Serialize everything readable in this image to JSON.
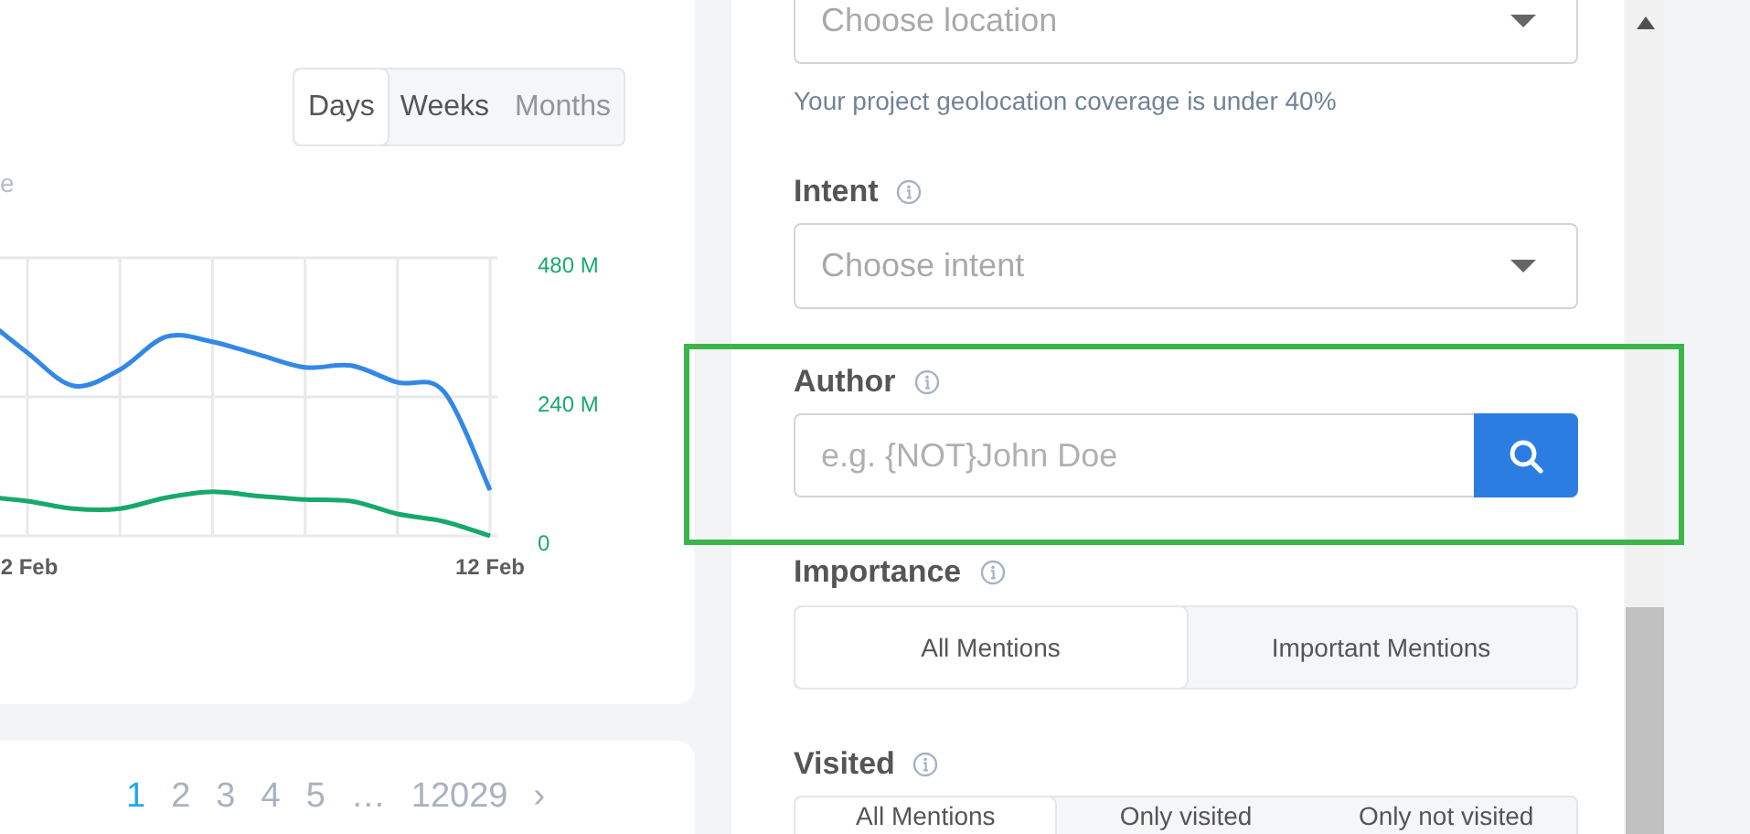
{
  "chart_card": {
    "range_tabs": [
      {
        "label": "Days",
        "selected": true,
        "disabled": false
      },
      {
        "label": "Weeks",
        "selected": false,
        "disabled": false
      },
      {
        "label": "Months",
        "selected": false,
        "disabled": true
      }
    ],
    "legend_fragment": "e",
    "chart_data": {
      "type": "line",
      "grid": true,
      "categories": [
        null,
        "2 Feb",
        null,
        null,
        null,
        null,
        null,
        null,
        null,
        null,
        null,
        "12 Feb"
      ],
      "ylim": [
        0,
        480
      ],
      "yticks": [
        {
          "value": 0,
          "label": "0"
        },
        {
          "value": 240,
          "label": "240 M"
        },
        {
          "value": 480,
          "label": "480 M"
        }
      ],
      "series": [
        {
          "color": "#3388e6",
          "values": [
            380,
            316,
            259,
            287,
            344,
            335,
            313,
            291,
            294,
            265,
            249,
            79
          ]
        },
        {
          "color": "#17a96a",
          "values": [
            68,
            60,
            47,
            47,
            66,
            76,
            69,
            63,
            60,
            38,
            25,
            0
          ]
        }
      ]
    }
  },
  "pagination": {
    "pages": [
      {
        "label": "1",
        "selected": true
      },
      {
        "label": "2",
        "selected": false
      },
      {
        "label": "3",
        "selected": false
      },
      {
        "label": "4",
        "selected": false
      },
      {
        "label": "5",
        "selected": false
      },
      {
        "label": "…",
        "selected": false
      },
      {
        "label": "12029",
        "selected": false
      }
    ],
    "next": "›"
  },
  "filters": {
    "location": {
      "placeholder": "Choose location",
      "hint": "Your project geolocation coverage is under 40%"
    },
    "intent": {
      "label": "Intent",
      "placeholder": "Choose intent"
    },
    "author": {
      "label": "Author",
      "placeholder": "e.g. {NOT}John Doe",
      "highlighted": true
    },
    "importance": {
      "label": "Importance",
      "options": [
        {
          "label": "All Mentions",
          "selected": true
        },
        {
          "label": "Important Mentions",
          "selected": false
        }
      ]
    },
    "visited": {
      "label": "Visited",
      "options": [
        {
          "label": "All Mentions",
          "selected": true
        },
        {
          "label": "Only visited",
          "selected": false
        },
        {
          "label": "Only not visited",
          "selected": false
        }
      ]
    }
  }
}
